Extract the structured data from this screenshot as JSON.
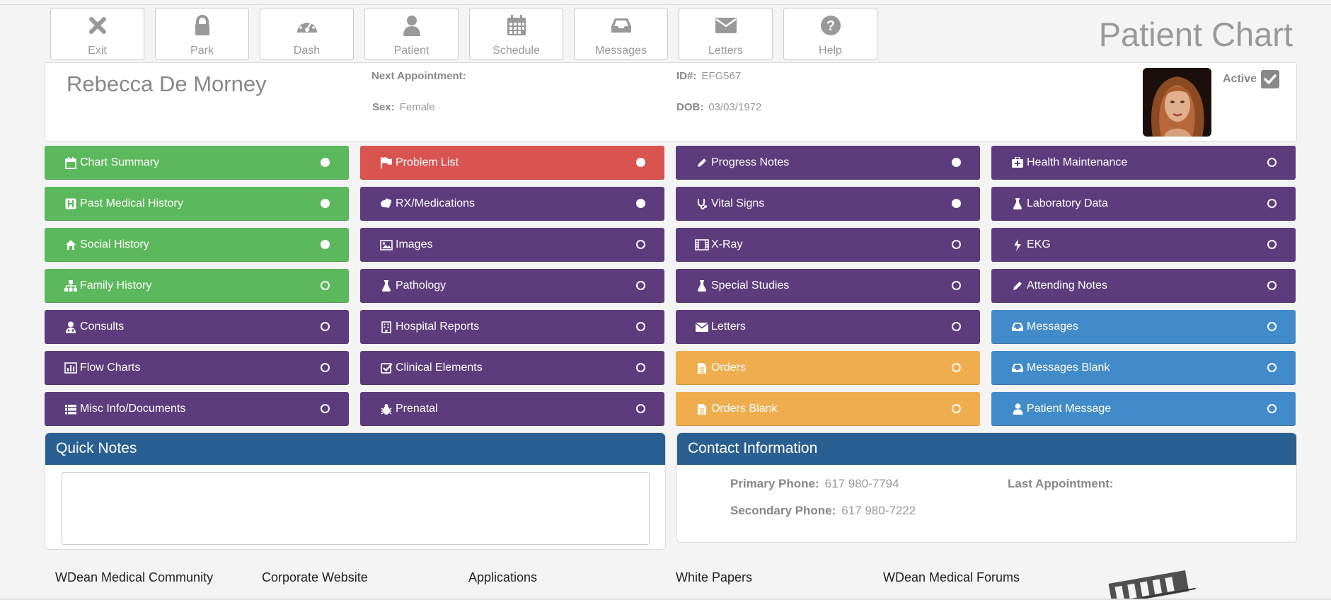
{
  "toolbar": [
    {
      "label": "Exit",
      "icon": "close-icon"
    },
    {
      "label": "Park",
      "icon": "lock-icon"
    },
    {
      "label": "Dash",
      "icon": "dashboard-icon"
    },
    {
      "label": "Patient",
      "icon": "user-icon"
    },
    {
      "label": "Schedule",
      "icon": "calendar-icon"
    },
    {
      "label": "Messages",
      "icon": "inbox-icon"
    },
    {
      "label": "Letters",
      "icon": "envelope-icon"
    },
    {
      "label": "Help",
      "icon": "help-icon"
    }
  ],
  "page_title": "Patient Chart",
  "patient": {
    "name": "Rebecca De Morney",
    "next_appointment_label": "Next Appointment:",
    "next_appointment_value": "",
    "sex_label": "Sex:",
    "sex_value": "Female",
    "id_label": "ID#:",
    "id_value": "EFG567",
    "dob_label": "DOB:",
    "dob_value": "03/03/1972",
    "active_label": "Active",
    "active_checked": true
  },
  "tiles": [
    {
      "label": "Chart Summary",
      "icon": "calendar-icon",
      "color": "#5cb85c",
      "filled": true
    },
    {
      "label": "Problem List",
      "icon": "flag-icon",
      "color": "#d9534f",
      "filled": true
    },
    {
      "label": "Progress Notes",
      "icon": "pencil-icon",
      "color": "#5c3c7c",
      "filled": true
    },
    {
      "label": "Health Maintenance",
      "icon": "medkit-icon",
      "color": "#5c3c7c",
      "filled": false
    },
    {
      "label": "Past Medical History",
      "icon": "hospital-h-icon",
      "color": "#5cb85c",
      "filled": true
    },
    {
      "label": "RX/Medications",
      "icon": "pills-icon",
      "color": "#5c3c7c",
      "filled": true
    },
    {
      "label": "Vital Signs",
      "icon": "stethoscope-icon",
      "color": "#5c3c7c",
      "filled": true
    },
    {
      "label": "Laboratory Data",
      "icon": "flask-icon",
      "color": "#5c3c7c",
      "filled": false
    },
    {
      "label": "Social History",
      "icon": "home-icon",
      "color": "#5cb85c",
      "filled": true
    },
    {
      "label": "Images",
      "icon": "image-icon",
      "color": "#5c3c7c",
      "filled": false
    },
    {
      "label": "X-Ray",
      "icon": "film-icon",
      "color": "#5c3c7c",
      "filled": false
    },
    {
      "label": "EKG",
      "icon": "bolt-icon",
      "color": "#5c3c7c",
      "filled": false
    },
    {
      "label": "Family History",
      "icon": "sitemap-icon",
      "color": "#5cb85c",
      "filled": false
    },
    {
      "label": "Pathology",
      "icon": "flask-icon",
      "color": "#5c3c7c",
      "filled": false
    },
    {
      "label": "Special Studies",
      "icon": "flask-icon",
      "color": "#5c3c7c",
      "filled": false
    },
    {
      "label": "Attending Notes",
      "icon": "pencil-icon",
      "color": "#5c3c7c",
      "filled": false
    },
    {
      "label": "Consults",
      "icon": "user-md-icon",
      "color": "#5c3c7c",
      "filled": false
    },
    {
      "label": "Hospital Reports",
      "icon": "building-icon",
      "color": "#5c3c7c",
      "filled": false
    },
    {
      "label": "Letters",
      "icon": "envelope-icon",
      "color": "#5c3c7c",
      "filled": false
    },
    {
      "label": "Messages",
      "icon": "inbox-icon",
      "color": "#428bca",
      "filled": false
    },
    {
      "label": "Flow Charts",
      "icon": "bar-chart-icon",
      "color": "#5c3c7c",
      "filled": false
    },
    {
      "label": "Clinical Elements",
      "icon": "check-square-icon",
      "color": "#5c3c7c",
      "filled": false
    },
    {
      "label": "Orders",
      "icon": "file-icon",
      "color": "#f0ad4e",
      "filled": false
    },
    {
      "label": "Messages Blank",
      "icon": "inbox-icon",
      "color": "#428bca",
      "filled": false
    },
    {
      "label": "Misc Info/Documents",
      "icon": "list-icon",
      "color": "#5c3c7c",
      "filled": false
    },
    {
      "label": "Prenatal",
      "icon": "bug-icon",
      "color": "#5c3c7c",
      "filled": false
    },
    {
      "label": "Orders Blank",
      "icon": "file-icon",
      "color": "#f0ad4e",
      "filled": false
    },
    {
      "label": "Patient Message",
      "icon": "user-icon",
      "color": "#428bca",
      "filled": false
    }
  ],
  "quick_notes": {
    "title": "Quick Notes",
    "value": ""
  },
  "contact": {
    "title": "Contact Information",
    "primary_label": "Primary Phone:",
    "primary_value": "617 980-7794",
    "secondary_label": "Secondary Phone:",
    "secondary_value": "617 980-7222",
    "last_appt_label": "Last Appointment:",
    "last_appt_value": ""
  },
  "footer_links": [
    "WDean Medical Community",
    "Corporate Website",
    "Applications",
    "White Papers",
    "WDean Medical Forums"
  ],
  "colors": {
    "header_blue": "#296091",
    "green": "#5cb85c",
    "red": "#d9534f",
    "purple": "#5c3c7c",
    "blue": "#428bca",
    "orange": "#f0ad4e"
  }
}
